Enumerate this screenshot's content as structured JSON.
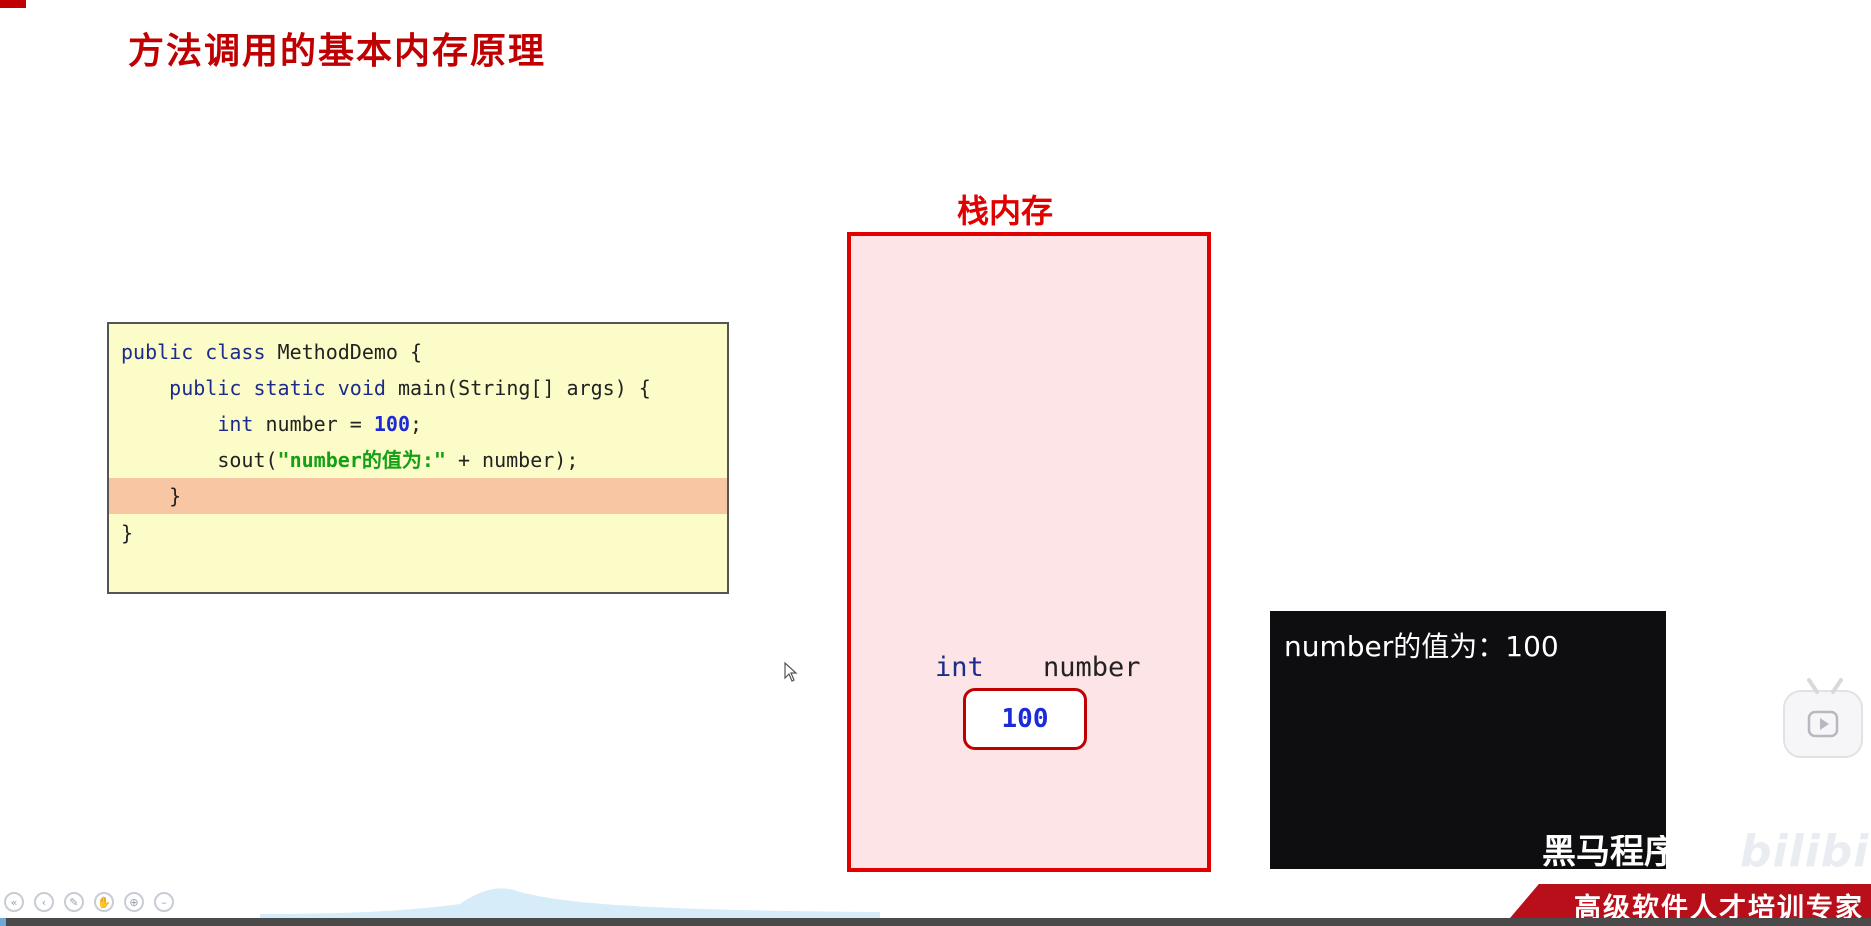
{
  "slide": {
    "title": "方法调用的基本内存原理"
  },
  "code": {
    "lines": [
      {
        "tokens": [
          [
            "kw",
            "public class "
          ],
          [
            "t",
            "MethodDemo {"
          ]
        ]
      },
      {
        "tokens": [
          [
            "t",
            "    "
          ],
          [
            "kw",
            "public static void "
          ],
          [
            "t",
            "main(String[] args) {"
          ]
        ]
      },
      {
        "tokens": [
          [
            "t",
            "        "
          ],
          [
            "kw",
            "int "
          ],
          [
            "t",
            "number = "
          ],
          [
            "num",
            "100"
          ],
          [
            "t",
            ";"
          ]
        ]
      },
      {
        "tokens": [
          [
            "t",
            "        sout("
          ],
          [
            "str",
            "\"number的值为:\""
          ],
          [
            "t",
            " + number);"
          ]
        ]
      },
      {
        "tokens": [
          [
            "t",
            "    }"
          ]
        ],
        "highlight": true
      },
      {
        "tokens": [
          [
            "t",
            "}"
          ]
        ]
      }
    ]
  },
  "stack": {
    "title": "栈内存",
    "variable": {
      "type": "int",
      "name": "number",
      "value": "100"
    }
  },
  "console": {
    "output": "number的值为：100",
    "watermark": "黑马程序员"
  },
  "banner": {
    "text": "高级软件人才培训专家"
  },
  "bilibili": {
    "watermark": "bilibili"
  },
  "player": {
    "progress_fraction": 0.003
  },
  "colors": {
    "title_red": "#c00000",
    "stack_border": "#e00000",
    "stack_fill": "#fde4e6",
    "code_bg": "#fcfcc8",
    "code_highlight": "#f9c6a3",
    "console_bg": "#0e0d0f"
  }
}
